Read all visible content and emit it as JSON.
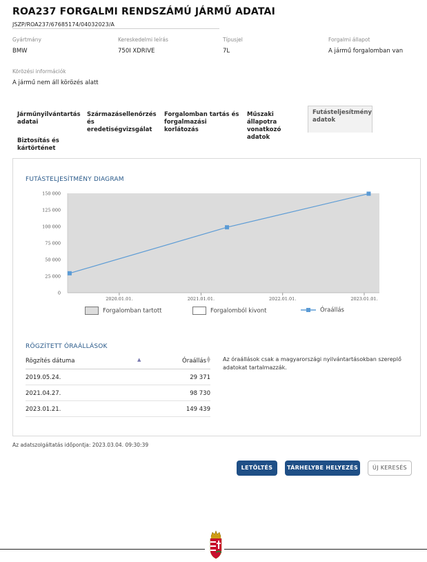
{
  "header": {
    "title": "ROA237 FORGALMI RENDSZÁMÚ JÁRMŰ ADATAI",
    "subtitle": "JSZP/ROA237/67685174/04032023/A"
  },
  "fields": [
    {
      "label": "Gyártmány",
      "value": "BMW"
    },
    {
      "label": "Kereskedelmi leírás",
      "value": "750I XDRIVE"
    },
    {
      "label": "Típusjel",
      "value": "7L"
    },
    {
      "label": "Forgalmi állapot",
      "value": "A jármű forgalomban van"
    }
  ],
  "wanted": {
    "label": "Körözési információk",
    "value": "A jármű nem áll körözés alatt"
  },
  "tabs": [
    {
      "label": "Járműnyilvántartás adatai"
    },
    {
      "label": "Származásellenőrzés és eredetiségvizsgálat"
    },
    {
      "label": "Forgalomban tartás és forgalmazási korlátozás"
    },
    {
      "label": "Műszaki állapotra vonatkozó adatok"
    },
    {
      "label": "Futásteljesítmény adatok"
    },
    {
      "label": "Biztosítás és kártörténet"
    }
  ],
  "chart_section_title": "FUTÁSTELJESÍTMÉNY DIAGRAM",
  "chart_data": {
    "type": "line",
    "y_ticks": [
      "150 000",
      "125 000",
      "100 000",
      "75 000",
      "50 000",
      "25 000",
      "0"
    ],
    "x_ticks": [
      "2020.01.01.",
      "2021.01.01.",
      "2022.01.01.",
      "2023.01.01."
    ],
    "ylim": [
      0,
      150000
    ],
    "series": [
      {
        "name": "Óraállás",
        "x": [
          "2019.05.24.",
          "2021.04.27.",
          "2023.01.21."
        ],
        "values": [
          29371,
          98730,
          149439
        ]
      }
    ],
    "legend": [
      "Forgalomban tartott",
      "Forgalomból kivont",
      "Óraállás"
    ],
    "colors": {
      "plot_bg": "#dcdcdc",
      "line": "#5b9bd5"
    }
  },
  "records": {
    "title": "RÖGZÍTETT ÓRAÁLLÁSOK",
    "columns": [
      "Rögzítés dátuma",
      "Óraállás"
    ],
    "rows": [
      [
        "2019.05.24.",
        "29 371"
      ],
      [
        "2021.04.27.",
        "98 730"
      ],
      [
        "2023.01.21.",
        "149 439"
      ]
    ],
    "note": "Az óraállások csak a magyarországi nyilvántartásokban szereplő adatokat tartalmazzák."
  },
  "timestamp": "Az adatszolgáltatás időpontja: 2023.03.04. 09:30:39",
  "buttons": {
    "download": "LETÖLTÉS",
    "storage": "TÁRHELYBE HELYEZÉS",
    "new_search": "ÚJ KERESÉS"
  },
  "colors": {
    "accent": "#1f4f86",
    "section_title": "#2a5a8a"
  }
}
